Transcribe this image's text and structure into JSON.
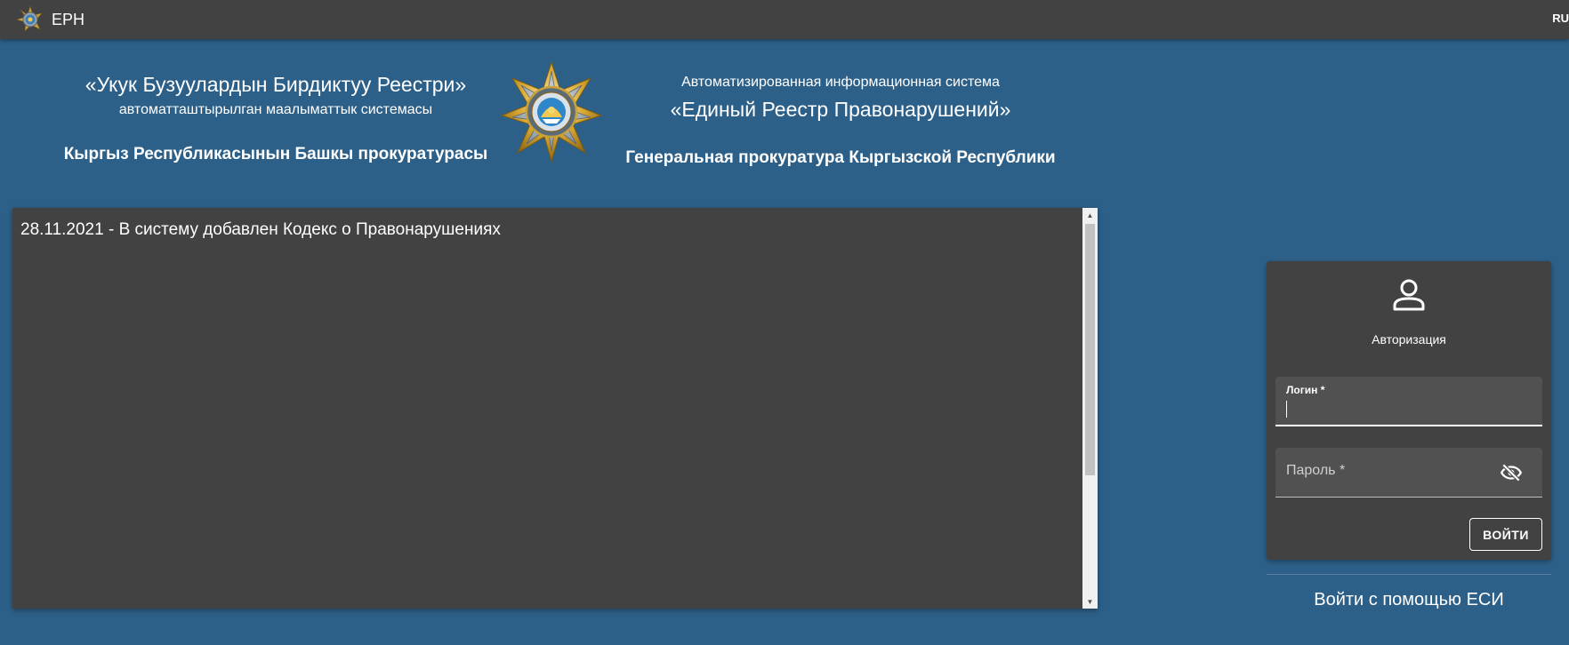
{
  "topbar": {
    "app_name": "ЕРН",
    "language": "RU",
    "logo_icon": "emblem-icon"
  },
  "header": {
    "left": {
      "title": "«Укук Бузуулардын Бирдиктуу Реестри»",
      "subtitle": "автоматташтырылган маалыматтык системасы",
      "organization": "Кыргыз Республикасынын Башкы прокуратурасы"
    },
    "right": {
      "subtitle": "Автоматизированная информационная система",
      "title": "«Единый Реестр Правонарушений»",
      "organization": "Генеральная прокуратура Кыргызской Республики"
    },
    "emblem_icon": "prosecutor-emblem-icon"
  },
  "news": {
    "items": [
      "28.11.2021 - В систему добавлен Кодекс о Правонарушениях"
    ]
  },
  "login": {
    "title": "Авторизация",
    "login_label": "Логин *",
    "login_value": "",
    "password_label": "Пароль *",
    "submit_label": "ВОЙТИ",
    "esi_label": "Войти с помощью ЕСИ"
  },
  "colors": {
    "background": "#2d6089",
    "panel": "#424242",
    "field": "#515151",
    "text": "#ffffff"
  }
}
